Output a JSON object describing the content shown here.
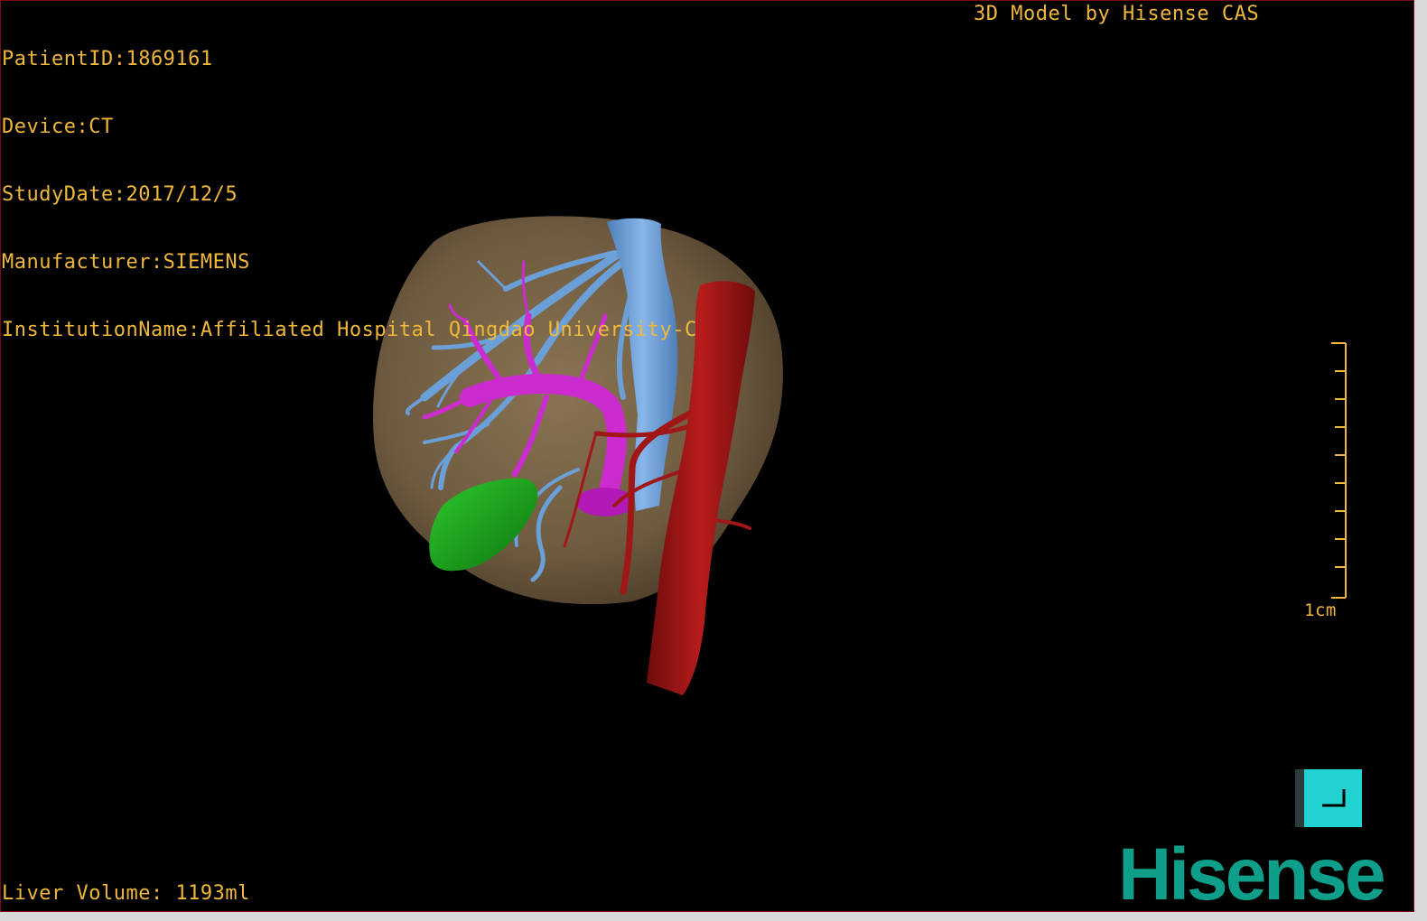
{
  "viewport": {
    "info_lines": [
      "PatientID:1869161",
      "Device:CT",
      "StudyDate:2017/12/5",
      "Manufacturer:SIEMENS",
      "InstitutionName:Affiliated Hospital Qingdao University-C"
    ],
    "credit": "3D Model by Hisense CAS",
    "liver_volume": "Liver Volume: 1193ml",
    "scale_label": "1cm",
    "text_color": "#f0b83a",
    "border_color": "#7a0c12"
  },
  "model": {
    "structures": [
      {
        "name": "liver",
        "color": "#7a6448"
      },
      {
        "name": "hepatic-vein",
        "color": "#6b9fd8"
      },
      {
        "name": "portal-vein",
        "color": "#cc2bd0"
      },
      {
        "name": "aorta",
        "color": "#a11616"
      },
      {
        "name": "tumor",
        "color": "#1aa01a"
      }
    ]
  },
  "corner_widget": {
    "color": "#22d3d1",
    "icon": "corner-bracket-icon"
  },
  "branding": {
    "logo_text": "Hisense",
    "logo_color": "#0e9e8a"
  }
}
